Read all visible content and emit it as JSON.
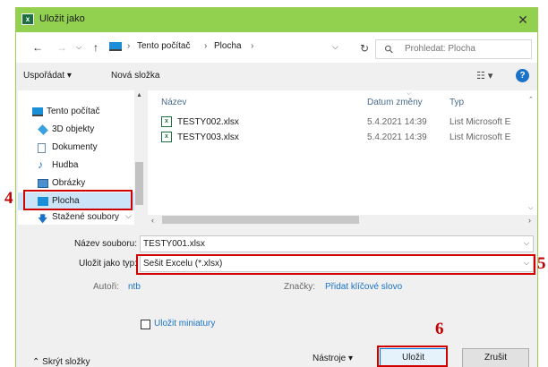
{
  "window": {
    "title": "Uložit jako",
    "app_icon_letter": "x"
  },
  "nav": {
    "back": "←",
    "forward": "→",
    "recent": "⌵",
    "up": "↑",
    "breadcrumbs": [
      "Tento počítač",
      "Plocha"
    ],
    "separator": "›",
    "dropdown": "⌵",
    "refresh": "↻",
    "search_placeholder": "Prohledat: Plocha"
  },
  "toolbar": {
    "organize": "Uspořádat ▾",
    "new_folder": "Nová složka",
    "view": "☷ ▾",
    "help": "?"
  },
  "tree": [
    {
      "label": "Tento počítač",
      "icon": "computer-icon",
      "color": "#1a8fd8"
    },
    {
      "label": "3D objekty",
      "icon": "cube-icon",
      "color": "#3aa0e0"
    },
    {
      "label": "Dokumenty",
      "icon": "document-icon",
      "color": "#8ab0d0"
    },
    {
      "label": "Hudba",
      "icon": "music-icon",
      "color": "#1a73c9"
    },
    {
      "label": "Obrázky",
      "icon": "picture-icon",
      "color": "#4a8fcf"
    },
    {
      "label": "Plocha",
      "icon": "desktop-icon",
      "color": "#1a8fd8"
    },
    {
      "label": "Stažené soubory",
      "icon": "download-icon",
      "color": "#1a73c9"
    }
  ],
  "columns": {
    "name": "Název",
    "date": "Datum změny",
    "type": "Typ"
  },
  "files": [
    {
      "name": "TESTY002.xlsx",
      "date": "5.4.2021 14:39",
      "type": "List Microsoft E"
    },
    {
      "name": "TESTY003.xlsx",
      "date": "5.4.2021 14:39",
      "type": "List Microsoft E"
    }
  ],
  "form": {
    "filename_label": "Název souboru:",
    "filename_value": "TESTY001.xlsx",
    "type_label": "Uložit jako typ:",
    "type_value": "Sešit Excelu (*.xlsx)",
    "authors_label": "Autoři:",
    "authors_value": "ntb",
    "tags_label": "Značky:",
    "tags_value": "Přidat klíčové slovo",
    "thumbnails_label": "Uložit miniatury",
    "hide_folders": "⌃ Skrýt složky",
    "tools": "Nástroje ▾",
    "save": "Uložit",
    "cancel": "Zrušit"
  },
  "markers": {
    "m4": "4",
    "m5": "5",
    "m6": "6"
  },
  "colors": {
    "titlebar": "#92d050",
    "annotation": "#d00000",
    "link": "#1a73c9"
  }
}
